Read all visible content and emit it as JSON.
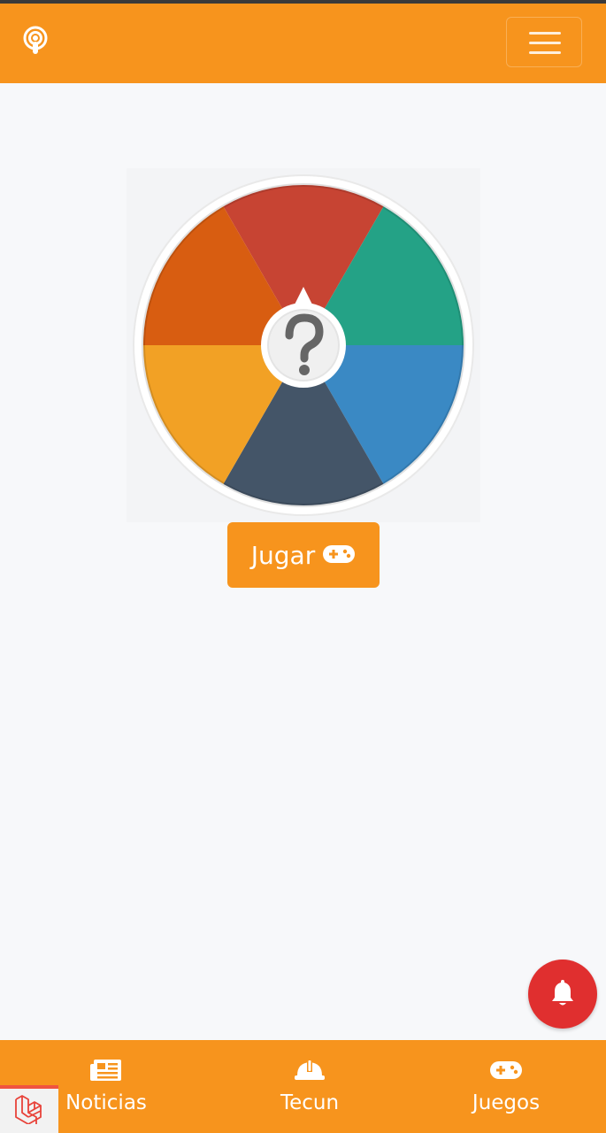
{
  "header": {
    "brand_icon": "podcast-icon",
    "menu_icon": "hamburger-menu-icon"
  },
  "wheel": {
    "segment_colors": [
      "#c74433",
      "#24a286",
      "#3a89c4",
      "#445568",
      "#f2a125",
      "#d85d11"
    ],
    "center_icon": "question-mark-icon"
  },
  "play_button": {
    "label": "Jugar",
    "icon": "gamepad-icon"
  },
  "notification_button": {
    "icon": "bell-icon",
    "color": "#e02f2f"
  },
  "bottom_nav": {
    "items": [
      {
        "label": "Noticias",
        "icon": "newspaper-icon"
      },
      {
        "label": "Tecun",
        "icon": "hard-hat-icon"
      },
      {
        "label": "Juegos",
        "icon": "gamepad-icon"
      }
    ]
  },
  "debug_badge": {
    "icon": "laravel-logo-icon"
  },
  "colors": {
    "accent": "#f7941d",
    "background": "#f7f8fa"
  }
}
